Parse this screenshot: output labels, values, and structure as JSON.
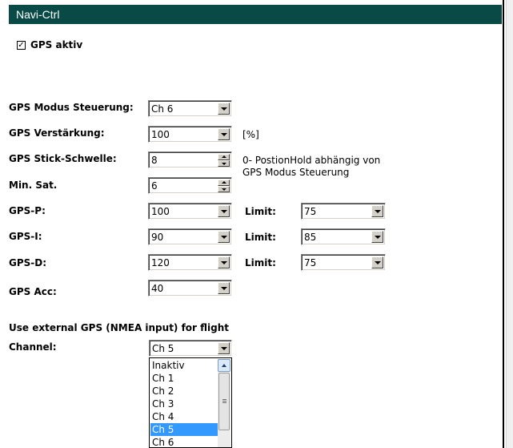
{
  "window": {
    "title": "Navi-Ctrl"
  },
  "gps_active": {
    "label": "GPS aktiv",
    "checked": true
  },
  "fields": {
    "mode": {
      "label": "GPS Modus Steuerung:",
      "value": "Ch 6"
    },
    "gain": {
      "label": "GPS Verstärkung:",
      "value": "100",
      "unit": "[%]"
    },
    "stick": {
      "label": "GPS Stick-Schwelle:",
      "value": "8",
      "note_line1": "0- PostionHold abhängig von",
      "note_line2": "GPS Modus Steuerung"
    },
    "minsat": {
      "label": "Min. Sat.",
      "value": "6"
    },
    "p": {
      "label": "GPS-P:",
      "value": "100",
      "limit_label": "Limit:",
      "limit_value": "75"
    },
    "i": {
      "label": "GPS-I:",
      "value": "90",
      "limit_label": "Limit:",
      "limit_value": "85"
    },
    "d": {
      "label": "GPS-D:",
      "value": "120",
      "limit_label": "Limit:",
      "limit_value": "75"
    },
    "acc": {
      "label": "GPS Acc:",
      "value": "40"
    }
  },
  "external": {
    "heading": "Use external GPS (NMEA input) for flight",
    "channel_label": "Channel:",
    "channel_value": "Ch 5",
    "options": [
      "Inaktiv",
      "Ch 1",
      "Ch 2",
      "Ch 3",
      "Ch 4",
      "Ch 5",
      "Ch 6"
    ],
    "selected_option": "Ch 5"
  },
  "colors": {
    "title_bar": "#0a4a46",
    "selection": "#3399ff"
  }
}
